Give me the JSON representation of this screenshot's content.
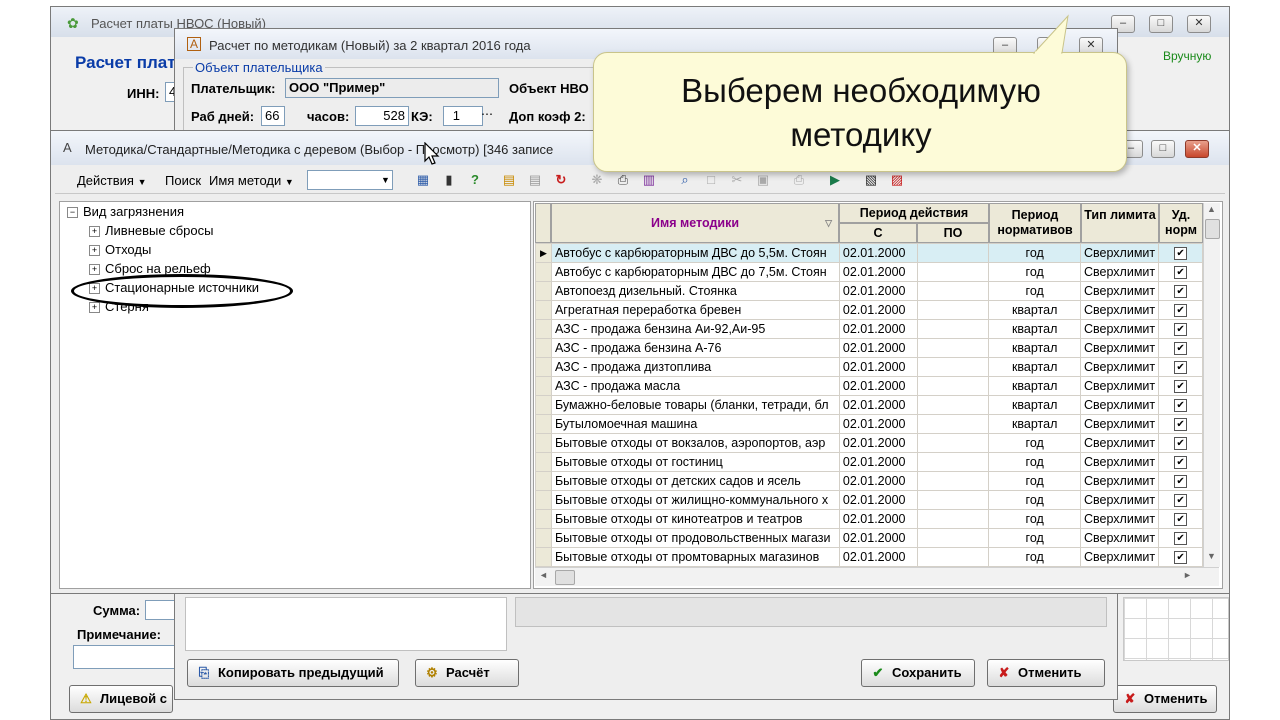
{
  "bg_window": {
    "title": "Расчет платы НВОС (Новый)",
    "heading": "Расчет плат",
    "inn_label": "ИНН:",
    "inn_value": "4",
    "mode_value": "Вручную",
    "sum_label": "Сумма:",
    "note_label": "Примечание:",
    "account_button": "Лицевой с",
    "cancel_button": "Отменить"
  },
  "calc_window": {
    "title": "Расчет по методикам (Новый) за 2 квартал 2016 года",
    "group_label": "Объект плательщика",
    "payer_label": "Плательщик:",
    "payer_value": "ООО \"Пример\"",
    "object_label": "Объект НВО",
    "workdays_label": "Раб дней:",
    "workdays_value": "66",
    "hours_label": "часов:",
    "hours_value": "528",
    "ke_label": "КЭ:",
    "ke_value": "1",
    "extra_coef_label": "Доп коэф 2:",
    "copy_button": "Копировать предыдущий",
    "calc_button": "Расчёт",
    "save_button": "Сохранить",
    "cancel_button": "Отменить"
  },
  "tooltip": {
    "text": "Выберем необходимую методику"
  },
  "method_window": {
    "title": "Методика/Стандартные/Методика с деревом (Выбор - Просмотр) [346 записе",
    "toolbar": {
      "actions_label": "Действия",
      "search_label": "Поиск",
      "search_field": "Имя методи",
      "search_value": ""
    },
    "tree": {
      "root": "Вид загрязнения",
      "children": [
        "Ливневые сбросы",
        "Отходы",
        "Сброс на рельеф",
        "Стационарные источники",
        "Стерня"
      ]
    },
    "grid": {
      "headers": {
        "name": "Имя методики",
        "period": "Период действия",
        "from": "С",
        "to": "ПО",
        "norm_period": "Период нормативов",
        "limit_type": "Тип лимита",
        "ud": "Уд. норм"
      },
      "rows": [
        [
          "Автобус с карбюраторным ДВС до 5,5м. Стоян",
          "02.01.2000",
          "",
          "год",
          "Сверхлимит"
        ],
        [
          "Автобус с карбюраторным ДВС до 7,5м. Стоян",
          "02.01.2000",
          "",
          "год",
          "Сверхлимит"
        ],
        [
          "Автопоезд дизельный. Стоянка",
          "02.01.2000",
          "",
          "год",
          "Сверхлимит"
        ],
        [
          "Агрегатная переработка бревен",
          "02.01.2000",
          "",
          "квартал",
          "Сверхлимит"
        ],
        [
          "АЗС - продажа бензина Аи-92,Аи-95",
          "02.01.2000",
          "",
          "квартал",
          "Сверхлимит"
        ],
        [
          "АЗС - продажа бензина А-76",
          "02.01.2000",
          "",
          "квартал",
          "Сверхлимит"
        ],
        [
          "АЗС - продажа дизтоплива",
          "02.01.2000",
          "",
          "квартал",
          "Сверхлимит"
        ],
        [
          "АЗС - продажа масла",
          "02.01.2000",
          "",
          "квартал",
          "Сверхлимит"
        ],
        [
          "Бумажно-беловые товары (бланки, тетради, бл",
          "02.01.2000",
          "",
          "квартал",
          "Сверхлимит"
        ],
        [
          "Бутыломоечная машина",
          "02.01.2000",
          "",
          "квартал",
          "Сверхлимит"
        ],
        [
          "Бытовые отходы от вокзалов, аэропортов, аэр",
          "02.01.2000",
          "",
          "год",
          "Сверхлимит"
        ],
        [
          "Бытовые отходы от гостиниц",
          "02.01.2000",
          "",
          "год",
          "Сверхлимит"
        ],
        [
          "Бытовые отходы от детских садов и ясель",
          "02.01.2000",
          "",
          "год",
          "Сверхлимит"
        ],
        [
          "Бытовые отходы от жилищно-коммунального х",
          "02.01.2000",
          "",
          "год",
          "Сверхлимит"
        ],
        [
          "Бытовые отходы от кинотеатров и театров",
          "02.01.2000",
          "",
          "год",
          "Сверхлимит"
        ],
        [
          "Бытовые отходы от продовольственных магази",
          "02.01.2000",
          "",
          "год",
          "Сверхлимит"
        ],
        [
          "Бытовые отходы от промтоварных магазинов",
          "02.01.2000",
          "",
          "год",
          "Сверхлимит"
        ]
      ],
      "check_mark": "✔"
    }
  },
  "colors": {
    "accent_title": "#0a3ca8",
    "selected_row": "#d8eef4",
    "header_name_color": "#8b008b",
    "tooltip_bg": "#fdfbd8",
    "green_text": "#1a8a1a"
  }
}
